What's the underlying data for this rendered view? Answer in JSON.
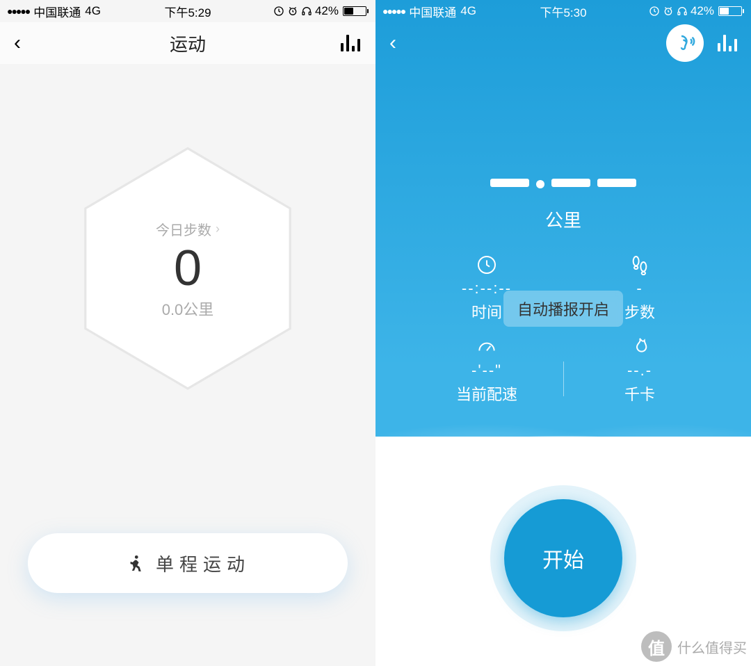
{
  "left": {
    "status": {
      "carrier": "中国联通",
      "network": "4G",
      "time": "下午5:29",
      "battery_pct": "42%"
    },
    "nav": {
      "title": "运动"
    },
    "hex": {
      "label": "今日步数",
      "value": "0",
      "distance": "0.0公里"
    },
    "single_btn": "单程运动"
  },
  "right": {
    "status": {
      "carrier": "中国联通",
      "network": "4G",
      "time": "下午5:30",
      "battery_pct": "42%"
    },
    "distance_unit": "公里",
    "toast": "自动播报开启",
    "stats": {
      "time": {
        "value": "--:--:--",
        "label": "时间"
      },
      "steps": {
        "value": "-",
        "label": "步数"
      },
      "pace": {
        "value": "-'--\"",
        "label": "当前配速"
      },
      "cal": {
        "value": "--.-",
        "label": "千卡"
      }
    },
    "start": "开始"
  },
  "watermark": {
    "badge": "值",
    "text": "什么值得买"
  }
}
